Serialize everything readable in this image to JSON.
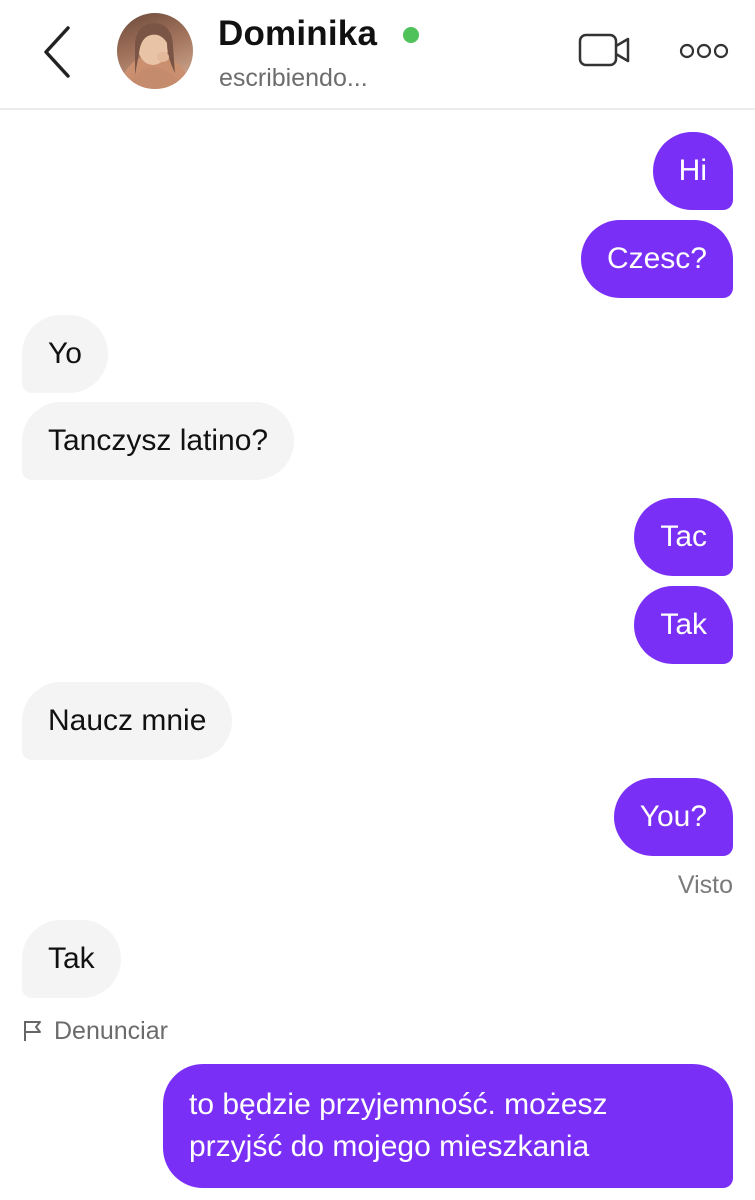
{
  "header": {
    "contact_name": "Dominika",
    "status": "escribiendo...",
    "online_color": "#4fc25a",
    "icons": [
      "back-arrow-icon",
      "video-call-icon",
      "more-options-icon"
    ]
  },
  "messages": [
    {
      "from": "me",
      "text": "Hi"
    },
    {
      "from": "me",
      "text": "Czesc?"
    },
    {
      "from": "contact",
      "text": "Yo"
    },
    {
      "from": "contact",
      "text": "Tanczysz latino?"
    },
    {
      "from": "me",
      "text": "Tac"
    },
    {
      "from": "me",
      "text": "Tak"
    },
    {
      "from": "contact",
      "text": "Naucz mnie"
    },
    {
      "from": "me",
      "text": "You?"
    },
    {
      "from": "contact",
      "text": "Tak"
    },
    {
      "from": "me",
      "text": "to będzie przyjemność. możesz przyjść do mojego mieszkania"
    }
  ],
  "seen_label": "Visto",
  "report_label": "Denunciar",
  "colors": {
    "outgoing_bubble": "#7a2ff7",
    "incoming_bubble": "#f4f4f4"
  }
}
